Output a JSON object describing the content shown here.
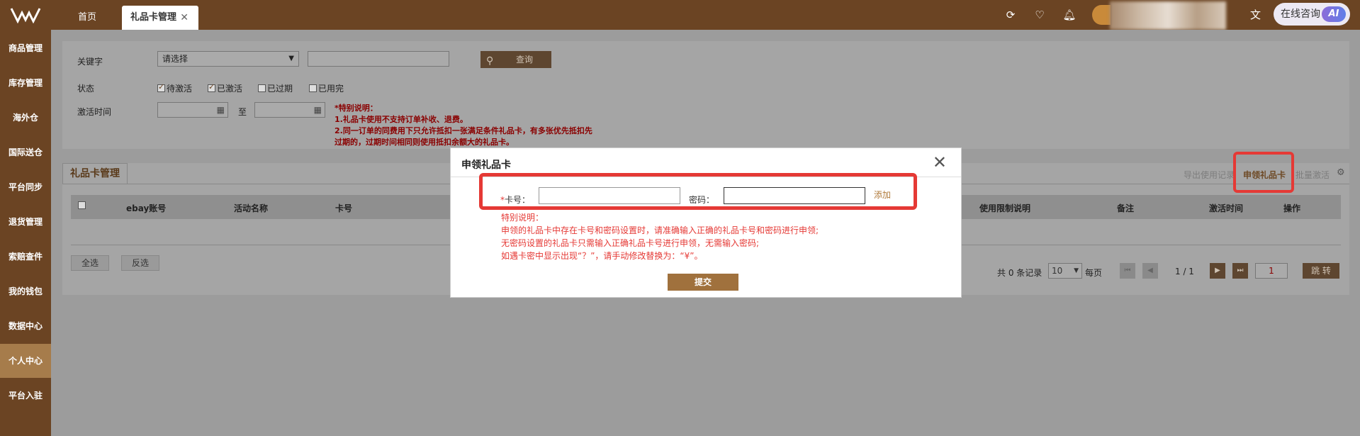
{
  "topbar": {
    "tab_home": "首页",
    "tab_active": "礼品卡管理",
    "tab_close_glyph": "✕",
    "icons": [
      "refresh-icon",
      "heart-icon",
      "bell-icon",
      "translate-icon"
    ],
    "consult_label": "在线咨询",
    "ai_badge": "AI"
  },
  "sidebar": {
    "items": [
      {
        "label": "商品管理"
      },
      {
        "label": "库存管理"
      },
      {
        "label": "海外仓"
      },
      {
        "label": "国际送仓"
      },
      {
        "label": "平台同步"
      },
      {
        "label": "退货管理"
      },
      {
        "label": "索赔查件"
      },
      {
        "label": "我的钱包"
      },
      {
        "label": "数据中心"
      },
      {
        "label": "个人中心"
      },
      {
        "label": "平台入驻"
      }
    ],
    "active_index": 9
  },
  "filter": {
    "keyword_label": "关键字",
    "keyword_select": "请选择",
    "keyword_input": "",
    "query_label": "查询",
    "status_label": "状态",
    "statuses": [
      {
        "label": "待激活",
        "checked": true
      },
      {
        "label": "已激活",
        "checked": true
      },
      {
        "label": "已过期",
        "checked": false
      },
      {
        "label": "已用完",
        "checked": false
      }
    ],
    "activate_time_label": "激活时间",
    "to_label": "至",
    "notes": [
      "*特别说明：",
      "1.礼品卡使用不支持订单补收、退费。",
      "2.同一订单的同费用下只允许抵扣一张满足条件礼品卡，有多张优先抵扣先",
      "过期的，过期时间相同则使用抵扣余额大的礼品卡。"
    ]
  },
  "panel": {
    "tab_label": "礼品卡管理",
    "links": {
      "export": "导出使用记录",
      "apply": "申领礼品卡",
      "batch": "批量激活"
    },
    "columns": [
      "ebay账号",
      "活动名称",
      "卡号",
      "使用限制说明",
      "备注",
      "激活时间",
      "操作"
    ],
    "select_all": "全选",
    "invert": "反选",
    "total_text": "共 0 条记录",
    "page_size": "10",
    "per_page": "每页",
    "page_info": "1 / 1",
    "page_input": "1",
    "jump_label": "跳 转"
  },
  "dialog": {
    "title": "申领礼品卡",
    "close_glyph": "✕",
    "card_required": "*",
    "card_label": "卡号：",
    "card_value": "",
    "password_label": "密码：",
    "password_value": "",
    "add_label": "添加",
    "instructions": [
      "特别说明：",
      "申领的礼品卡中存在卡号和密码设置时，请准确输入正确的礼品卡号和密码进行申领;",
      "无密码设置的礼品卡只需输入正确礼品卡号进行申领，无需输入密码;",
      "如遇卡密中显示出现“？”，请手动修改替换为：“¥”。"
    ],
    "submit_label": "提交"
  },
  "colors": {
    "brand": "#6b4423",
    "accent": "#a0713d",
    "highlight": "#e53935"
  }
}
